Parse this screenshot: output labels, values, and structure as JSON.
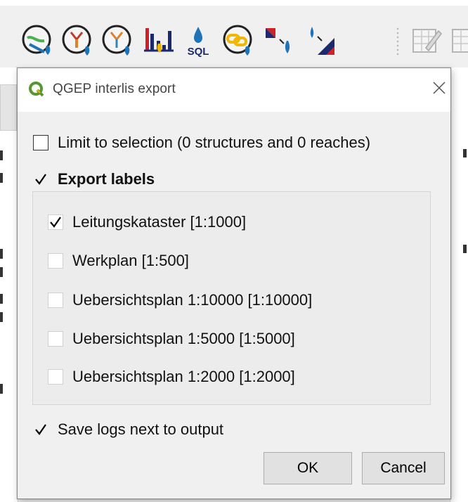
{
  "toolbar": {
    "icons": [
      "network-following-icon",
      "upstream-icon",
      "downstream-icon",
      "profile-icon",
      "sql-wizard-icon",
      "connect-wastewater-networkelement-icon",
      "refresh-network-icon",
      "data-model-icon",
      "edit-layer-icon",
      "edit-layer-partial-icon"
    ],
    "sql_label": "SQL"
  },
  "dialog": {
    "title": "QGEP interlis export",
    "limit_label": "Limit to selection (0 structures and 0 reaches)",
    "limit_checked": false,
    "export_labels_label": "Export labels",
    "export_labels_checked": true,
    "scales": [
      {
        "label": "Leitungskataster [1:1000]",
        "checked": true
      },
      {
        "label": "Werkplan [1:500]",
        "checked": false
      },
      {
        "label": "Uebersichtsplan 1:10000 [1:10000]",
        "checked": false
      },
      {
        "label": "Uebersichtsplan 1:5000 [1:5000]",
        "checked": false
      },
      {
        "label": "Uebersichtsplan 1:2000 [1:2000]",
        "checked": false
      }
    ],
    "save_logs_label": "Save logs next to output",
    "save_logs_checked": true,
    "ok_label": "OK",
    "cancel_label": "Cancel"
  },
  "colors": {
    "qgis_green": "#589632",
    "icon_blue": "#1f73b7",
    "icon_red": "#d0202a",
    "icon_navy": "#1a2a6c",
    "icon_yellow": "#f2b705"
  }
}
